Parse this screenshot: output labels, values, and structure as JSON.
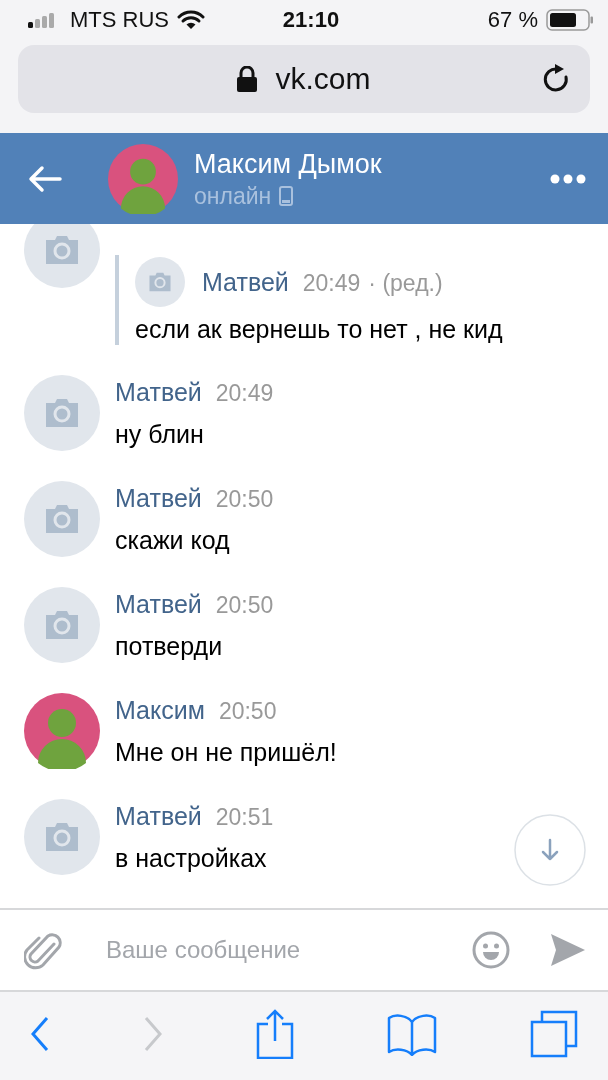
{
  "status_bar": {
    "carrier": "MTS RUS",
    "time": "21:10",
    "battery": "67 %"
  },
  "browser": {
    "url": "vk.com"
  },
  "header": {
    "name": "Максим Дымок",
    "status": "онлайн"
  },
  "messages": [
    {
      "kind": "camera",
      "forwarded": {
        "author": "Матвей",
        "time": "20:49",
        "edited": "· (ред.)",
        "text": "если ак вернешь то нет , не кид"
      }
    },
    {
      "kind": "camera",
      "author": "Матвей",
      "time": "20:49",
      "text": "ну блин"
    },
    {
      "kind": "camera",
      "author": "Матвей",
      "time": "20:50",
      "text": "скажи код"
    },
    {
      "kind": "camera",
      "author": "Матвей",
      "time": "20:50",
      "text": "потверди"
    },
    {
      "kind": "photo",
      "author": "Максим",
      "time": "20:50",
      "text": "Мне он не пришёл!"
    },
    {
      "kind": "camera",
      "author": "Матвей",
      "time": "20:51",
      "text": "в настройках"
    }
  ],
  "composer": {
    "placeholder": "Ваше сообщение"
  },
  "toolbar": {
    "forward_disabled": true
  }
}
